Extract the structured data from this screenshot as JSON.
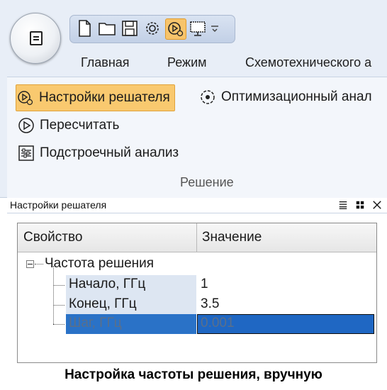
{
  "ribbon": {
    "tabs": [
      "Главная",
      "Режим",
      "Схемотехнического а"
    ],
    "quick_access": [
      {
        "icon": "new-file-icon"
      },
      {
        "icon": "open-folder-icon"
      },
      {
        "icon": "save-icon"
      },
      {
        "icon": "gear-icon"
      },
      {
        "icon": "solver-settings-icon",
        "active": true
      },
      {
        "icon": "screen-icon"
      },
      {
        "icon": "customize-dropdown-icon"
      }
    ],
    "buttons": {
      "solver_settings": "Настройки решателя",
      "optimization": "Оптимизационный анал",
      "recalculate": "Пересчитать",
      "tuning": "Подстроечный анализ"
    },
    "group_label": "Решение"
  },
  "panel": {
    "title": "Настройки решателя",
    "columns": {
      "property": "Свойство",
      "value": "Значение"
    },
    "category": "Частота решения",
    "rows": [
      {
        "name": "Начало, ГГц",
        "value": "1"
      },
      {
        "name": "Конец, ГГц",
        "value": "3.5"
      },
      {
        "name": "Шаг, ГГц",
        "value": "0.001"
      }
    ]
  },
  "caption": "Настройка частоты решения, вручную",
  "colors": {
    "accent": "#f9c96f",
    "selection": "#2a72c7",
    "ribbon_bg": "#e8eef7"
  }
}
